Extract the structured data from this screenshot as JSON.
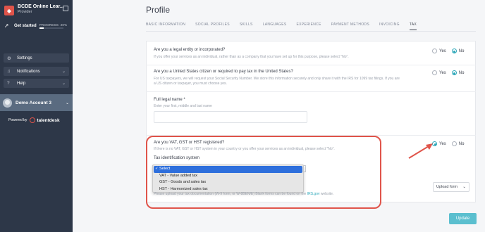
{
  "sidebar": {
    "brand_name": "BCDE Online Lear...",
    "brand_role": "Provider",
    "get_started": "Get started",
    "progress_text": "PROGRESS: 20%",
    "progress_value": 0.2,
    "nav": [
      {
        "label": "Settings",
        "icon": "gear-icon"
      },
      {
        "label": "Notifications",
        "icon": "bell-icon"
      },
      {
        "label": "Help",
        "icon": "help-icon"
      }
    ],
    "account_name": "Demo Account 3",
    "powered_by": "Powered by",
    "powered_brand": "talentdesk"
  },
  "header": {
    "title": "Profile",
    "tabs": [
      "BASIC INFORMATION",
      "SOCIAL PROFILES",
      "SKILLS",
      "LANGUAGES",
      "EXPERIENCE",
      "PAYMENT METHODS",
      "INVOICING",
      "TAX"
    ],
    "active_tab": "TAX"
  },
  "form": {
    "q1": {
      "question": "Are you a legal entity or incorporated?",
      "help": "If you offer your services as an individual, rather than as a company that you have set up for this purpose, please select \"No\".",
      "yes": "Yes",
      "no": "No",
      "selected": "No"
    },
    "q2": {
      "question": "Are you a United States citizen or required to pay tax in the United States?",
      "help1": "For US taxpayers, we will request your Social Security Number. We store this information securely and only share it with the IRS for 1099 tax filings. If you are",
      "help2": "a US citizen or taxpayer, you must choose yes.",
      "yes": "Yes",
      "no": "No",
      "selected": "No"
    },
    "legal_name": {
      "label": "Full legal name *",
      "help": "Enter your first, middle and last name",
      "value": ""
    },
    "q3": {
      "question": "Are you VAT, GST or HST registered?",
      "help": "If there is no VAT, GST or HST system in your country or you offer your services as an individual, please select \"No\".",
      "yes": "Yes",
      "no": "No",
      "selected": "Yes"
    },
    "tax_system": {
      "label": "Tax identification system",
      "options": [
        "Select",
        "VAT - Value added tax",
        "GST - Goods and sales tax",
        "HST - Harmonized sales tax"
      ],
      "selected": "Select"
    },
    "upload_note_pre": "Please upload your tax documentation (W-9 form, or W-8BEN/E) Blank forms can be found on the",
    "upload_link": "IRS.gov",
    "upload_note_post": "website.",
    "upload_button": "Upload form",
    "update_button": "Update"
  },
  "colors": {
    "sidebar": "#2d3748",
    "accent": "#2aa6b8",
    "annotation": "#e0544a",
    "dropdown_selected": "#2e6fdc"
  }
}
